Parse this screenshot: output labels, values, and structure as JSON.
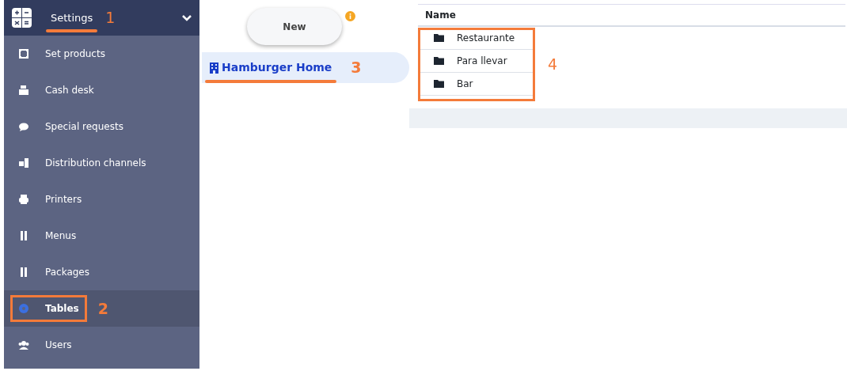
{
  "sidebar": {
    "header": {
      "title": "Settings",
      "expanded": true,
      "annotation": {
        "kind": "underline",
        "number": "1"
      }
    },
    "items": [
      {
        "label": "Set products",
        "selected": false
      },
      {
        "label": "Cash desk",
        "selected": false
      },
      {
        "label": "Special requests",
        "selected": false
      },
      {
        "label": "Distribution channels",
        "selected": false
      },
      {
        "label": "Printers",
        "selected": false
      },
      {
        "label": "Menus",
        "selected": false
      },
      {
        "label": "Packages",
        "selected": false
      },
      {
        "label": "Tables",
        "selected": true,
        "annotation": {
          "kind": "box",
          "number": "2"
        }
      },
      {
        "label": "Users",
        "selected": false
      }
    ]
  },
  "middle": {
    "new_button": "New",
    "locations": [
      {
        "label": "Hamburger Home",
        "selected": true,
        "annotation": {
          "kind": "underline",
          "number": "3"
        }
      }
    ]
  },
  "table": {
    "columns": [
      "Name"
    ],
    "rows": [
      {
        "name": "Restaurante"
      },
      {
        "name": "Para llevar"
      },
      {
        "name": "Bar"
      }
    ],
    "annotation": {
      "kind": "box",
      "number": "4"
    }
  }
}
